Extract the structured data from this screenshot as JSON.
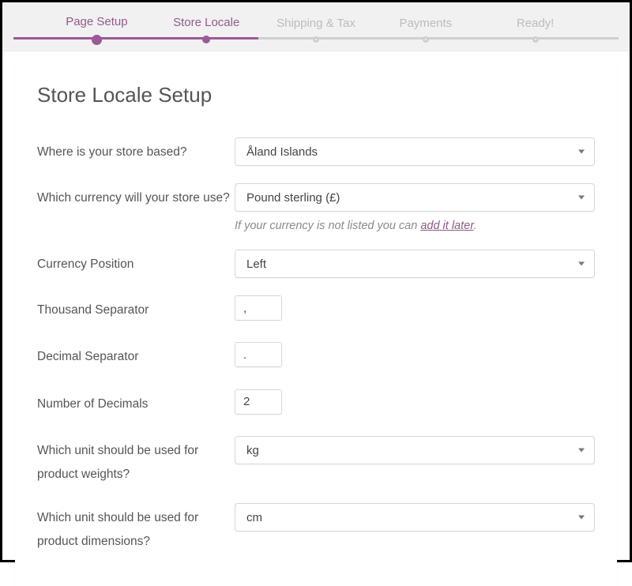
{
  "wizard": {
    "steps": [
      {
        "label": "Page Setup",
        "state": "done"
      },
      {
        "label": "Store Locale",
        "state": "active"
      },
      {
        "label": "Shipping & Tax",
        "state": "future"
      },
      {
        "label": "Payments",
        "state": "future"
      },
      {
        "label": "Ready!",
        "state": "future"
      }
    ]
  },
  "page": {
    "title": "Store Locale Setup"
  },
  "form": {
    "store_based_label": "Where is your store based?",
    "store_based_value": "Åland Islands",
    "currency_label": "Which currency will your store use?",
    "currency_value": "Pound sterling (£)",
    "currency_help_prefix": "If your currency is not listed you can ",
    "currency_help_link": "add it later",
    "currency_help_suffix": ".",
    "currency_position_label": "Currency Position",
    "currency_position_value": "Left",
    "thousand_sep_label": "Thousand Separator",
    "thousand_sep_value": ",",
    "decimal_sep_label": "Decimal Separator",
    "decimal_sep_value": ".",
    "num_decimals_label": "Number of Decimals",
    "num_decimals_value": "2",
    "weight_unit_label": "Which unit should be used for product weights?",
    "weight_unit_value": "kg",
    "dimension_unit_label": "Which unit should be used for product dimensions?",
    "dimension_unit_value": "cm"
  }
}
